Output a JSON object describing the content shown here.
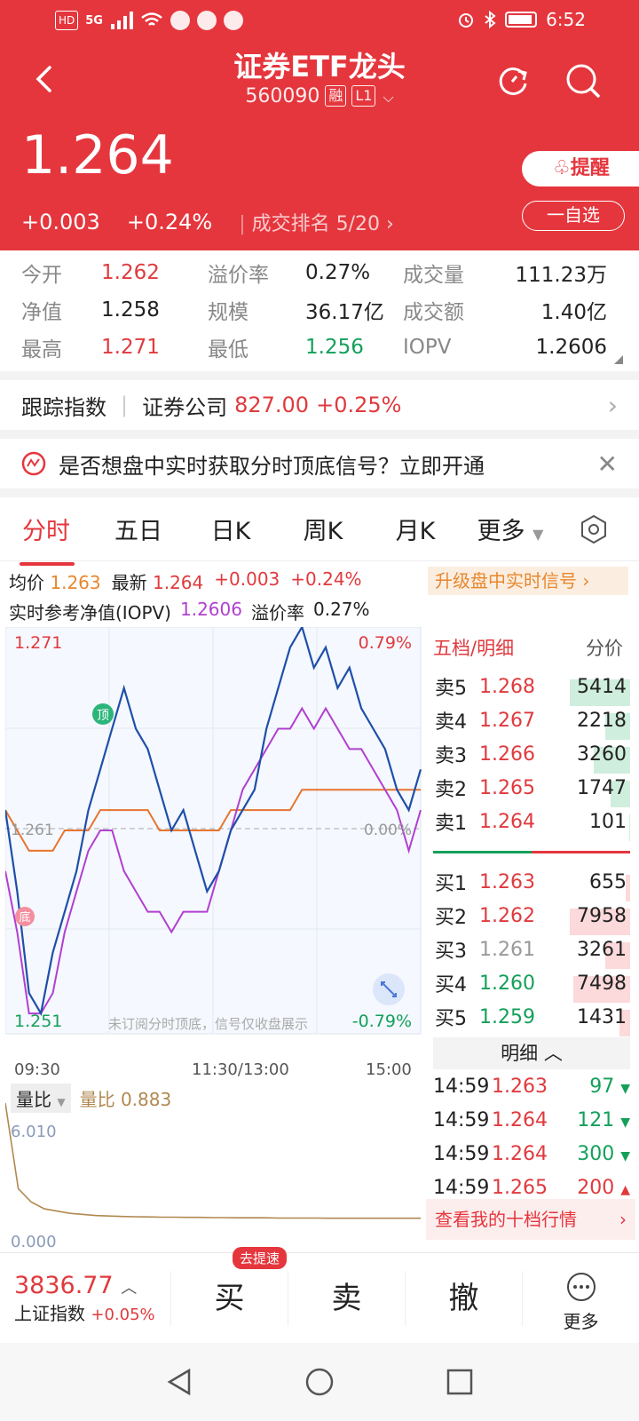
{
  "statusbar": {
    "left_chips": [
      "HD",
      "5G"
    ],
    "time": "6:52"
  },
  "header": {
    "title": "证券ETF龙头",
    "code": "560090",
    "tag_margin": "融",
    "tag_level": "L1",
    "price": "1.264",
    "change": "+0.003",
    "change_pct": "+0.24%",
    "rank_label": "成交排名",
    "rank_value": "5/20",
    "alert_label": "提醒",
    "add_label": "一自选"
  },
  "stats": [
    [
      {
        "label": "今开",
        "value": "1.262",
        "color": "red"
      },
      {
        "label": "溢价率",
        "value": "0.27%",
        "color": "black"
      },
      {
        "label": "成交量",
        "value": "111.23万",
        "color": "black"
      }
    ],
    [
      {
        "label": "净值",
        "value": "1.258",
        "color": "black"
      },
      {
        "label": "规模",
        "value": "36.17亿",
        "color": "black"
      },
      {
        "label": "成交额",
        "value": "1.40亿",
        "color": "black"
      }
    ],
    [
      {
        "label": "最高",
        "value": "1.271",
        "color": "red"
      },
      {
        "label": "最低",
        "value": "1.256",
        "color": "green"
      },
      {
        "label": "IOPV",
        "value": "1.2606",
        "color": "black"
      }
    ]
  ],
  "tracking": {
    "label": "跟踪指数",
    "index_name": "证券公司",
    "index_value": "827.00",
    "index_change": "+0.25%"
  },
  "banner": {
    "text": "是否想盘中实时获取分时顶底信号？立即开通"
  },
  "tabs": [
    "分时",
    "五日",
    "日K",
    "周K",
    "月K",
    "更多"
  ],
  "info": {
    "avg_label": "均价",
    "avg_value": "1.263",
    "latest_label": "最新",
    "latest_value": "1.264",
    "latest_change": "+0.003",
    "latest_pct": "+0.24%",
    "upgrade": "升级盘中实时信号",
    "iopv_label": "实时参考净值(IOPV)",
    "iopv_value": "1.2606",
    "premium_label": "溢价率",
    "premium_value": "0.27%"
  },
  "chart": {
    "high_label": "1.271",
    "low_label": "1.251",
    "high_pct": "0.79%",
    "low_pct": "-0.79%",
    "ref_label": "1.261",
    "ref_pct": "0.00%",
    "notice": "未订阅分时顶底，信号仅收盘展示",
    "top_marker": "顶",
    "bottom_marker": "底",
    "time_labels": [
      "09:30",
      "11:30/13:00",
      "15:00"
    ],
    "colors": {
      "price": "#1f4fa8",
      "iopv": "#b13fd0",
      "avg": "#e8742e"
    },
    "price_series": [
      1.262,
      1.258,
      1.253,
      1.252,
      1.255,
      1.257,
      1.259,
      1.262,
      1.264,
      1.266,
      1.268,
      1.266,
      1.265,
      1.263,
      1.261,
      1.262,
      1.26,
      1.258,
      1.259,
      1.261,
      1.262,
      1.263,
      1.266,
      1.268,
      1.27,
      1.271,
      1.269,
      1.27,
      1.268,
      1.269,
      1.267,
      1.266,
      1.265,
      1.263,
      1.262,
      1.264
    ],
    "iopv_series": [
      1.259,
      1.256,
      1.252,
      1.252,
      1.253,
      1.256,
      1.258,
      1.26,
      1.261,
      1.261,
      1.259,
      1.258,
      1.257,
      1.257,
      1.256,
      1.257,
      1.257,
      1.257,
      1.259,
      1.261,
      1.263,
      1.264,
      1.265,
      1.266,
      1.266,
      1.267,
      1.266,
      1.267,
      1.266,
      1.265,
      1.265,
      1.264,
      1.263,
      1.262,
      1.26,
      1.262
    ],
    "avg_series": [
      1.262,
      1.261,
      1.26,
      1.26,
      1.26,
      1.261,
      1.261,
      1.261,
      1.262,
      1.262,
      1.262,
      1.262,
      1.262,
      1.261,
      1.261,
      1.261,
      1.261,
      1.261,
      1.261,
      1.262,
      1.262,
      1.262,
      1.262,
      1.262,
      1.262,
      1.263,
      1.263,
      1.263,
      1.263,
      1.263,
      1.263,
      1.263,
      1.263,
      1.263,
      1.263,
      1.263
    ]
  },
  "volume": {
    "label": "量比",
    "ratio_label": "量比",
    "ratio_value": "0.883",
    "max_label": "6.010",
    "min_label": "0.000",
    "series": [
      6.01,
      2.2,
      1.6,
      1.3,
      1.2,
      1.1,
      1.05,
      1.0,
      0.98,
      0.96,
      0.95,
      0.94,
      0.93,
      0.93,
      0.92,
      0.92,
      0.91,
      0.91,
      0.9,
      0.9,
      0.9,
      0.89,
      0.89,
      0.89,
      0.89,
      0.88,
      0.88,
      0.88,
      0.88,
      0.88,
      0.88,
      0.88,
      0.883
    ]
  },
  "orderbook": {
    "title": "五档/明细",
    "title2": "分价",
    "asks": [
      {
        "label": "卖5",
        "price": "1.268",
        "vol": "5414",
        "pcolor": "red",
        "bar": 1.0
      },
      {
        "label": "卖4",
        "price": "1.267",
        "vol": "2218",
        "pcolor": "red",
        "bar": 0.41
      },
      {
        "label": "卖3",
        "price": "1.266",
        "vol": "3260",
        "pcolor": "red",
        "bar": 0.6
      },
      {
        "label": "卖2",
        "price": "1.265",
        "vol": "1747",
        "pcolor": "red",
        "bar": 0.32
      },
      {
        "label": "卖1",
        "price": "1.264",
        "vol": "101",
        "pcolor": "red",
        "bar": 0.02
      }
    ],
    "bids": [
      {
        "label": "买1",
        "price": "1.263",
        "vol": "655",
        "pcolor": "red",
        "bar": 0.08
      },
      {
        "label": "买2",
        "price": "1.262",
        "vol": "7958",
        "pcolor": "red",
        "bar": 1.0
      },
      {
        "label": "买3",
        "price": "1.261",
        "vol": "3261",
        "pcolor": "gray",
        "bar": 0.41
      },
      {
        "label": "买4",
        "price": "1.260",
        "vol": "7498",
        "pcolor": "green",
        "bar": 0.94
      },
      {
        "label": "买5",
        "price": "1.259",
        "vol": "1431",
        "pcolor": "green",
        "bar": 0.18
      }
    ],
    "detail_label": "明细",
    "trades": [
      {
        "time": "14:59",
        "price": "1.263",
        "vol": "97",
        "dir": "down"
      },
      {
        "time": "14:59",
        "price": "1.264",
        "vol": "121",
        "dir": "down"
      },
      {
        "time": "14:59",
        "price": "1.264",
        "vol": "300",
        "dir": "down"
      },
      {
        "time": "14:59",
        "price": "1.265",
        "vol": "200",
        "dir": "up"
      }
    ],
    "view_more": "查看我的十档行情"
  },
  "bottom": {
    "index_value": "3836.77",
    "index_name": "上证指数",
    "index_change": "+0.05%",
    "buy": "买",
    "sell": "卖",
    "cancel": "撤",
    "more": "更多",
    "speed_tag": "去提速"
  }
}
